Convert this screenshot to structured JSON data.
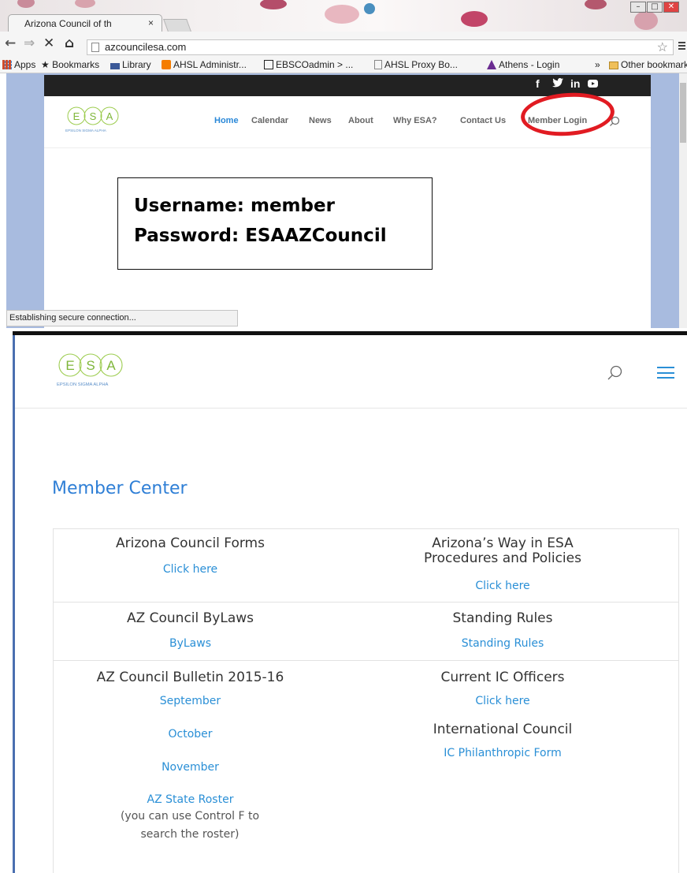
{
  "browser": {
    "tab_title": "Arizona Council of th",
    "tab_close": "×",
    "url": "azcouncilesa.com",
    "status": "Establishing secure connection...",
    "window_min": "–",
    "window_max": "□",
    "window_close": "✕",
    "nav": {
      "back": "←",
      "forward": "⇒",
      "stop": "✕",
      "home": "⌂"
    },
    "star": "☆"
  },
  "bookmarks": {
    "items": [
      {
        "label": "Apps",
        "icon": "apps-icon",
        "color": "#d14b2a"
      },
      {
        "label": "Bookmarks",
        "icon": "star-icon",
        "color": "#444444"
      },
      {
        "label": "Library",
        "icon": "library-icon",
        "color": "#3b5998"
      },
      {
        "label": "AHSL Administr...",
        "icon": "blogger-icon",
        "color": "#f57d00"
      },
      {
        "label": "EBSCOadmin > ...",
        "icon": "ebsco-icon",
        "color": "#222222"
      },
      {
        "label": "AHSL Proxy Bo...",
        "icon": "page-icon",
        "color": "#888888"
      },
      {
        "label": "Athens - Login",
        "icon": "athens-icon",
        "color": "#6a2c91"
      }
    ],
    "overflow": "»",
    "other": "Other bookmarks"
  },
  "site": {
    "social": [
      "f",
      "y",
      "in",
      "▶"
    ],
    "nav": [
      "Home",
      "Calendar",
      "News",
      "About",
      "Why ESA?",
      "Contact Us",
      "Member Login"
    ],
    "logo_letters": [
      "E",
      "S",
      "A"
    ],
    "logo_caption": "EPSILON SIGMA ALPHA",
    "accent": "#2a88d8"
  },
  "credentials": {
    "username": "Username: member",
    "password": "Password: ESAAZCouncil"
  },
  "mobile": {
    "logo_caption": "EPSILON SIGMA ALPHA",
    "title": "Member Center",
    "left": {
      "forms_title": "Arizona Council Forms",
      "forms_link": "Click here",
      "bylaws_title": "AZ Council ByLaws",
      "bylaws_link": "ByLaws",
      "bulletin_title": "AZ Council Bulletin 2015-16",
      "months": [
        "September",
        "October",
        "November"
      ],
      "roster_link": "AZ State Roster",
      "roster_note": "(you can use Control F to search the roster)"
    },
    "right": {
      "ways_title": "Arizona’s Way in ESA Procedures and Policies",
      "ways_link": "Click here",
      "rules_title": "Standing Rules",
      "rules_link": "Standing Rules",
      "officers_title": "Current IC Officers",
      "officers_link": "Click here",
      "intl_title": "International Council",
      "intl_link": "IC Philanthropic Form"
    }
  }
}
